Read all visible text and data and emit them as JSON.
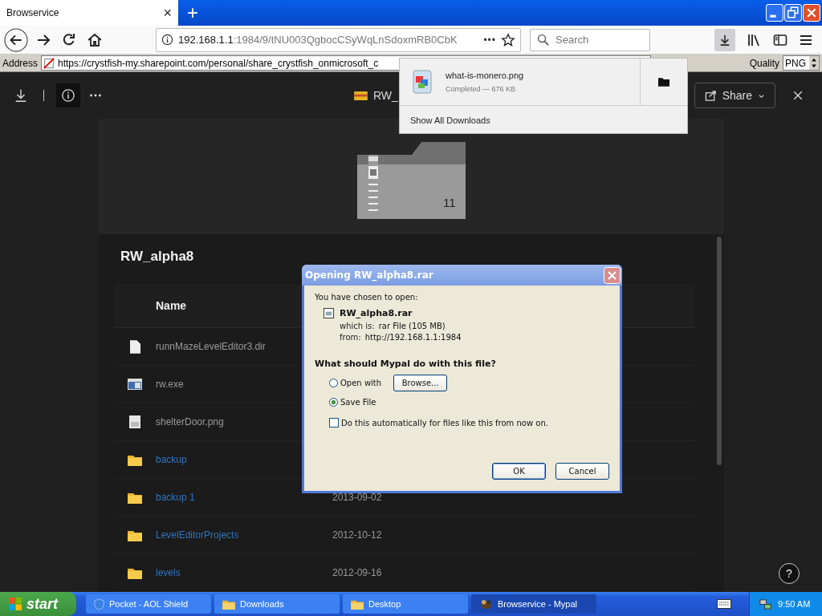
{
  "browser": {
    "tab": {
      "title": "Browservice",
      "close": "×"
    },
    "new_tab": "+",
    "url": {
      "host": "192.168.1.1",
      "path": ":1984/9/tNU003QgbocCSyWqLnSdoxmRB0CbK"
    },
    "page_actions": "•••",
    "search": {
      "placeholder": "Search"
    },
    "downloads_active": true
  },
  "address_bar": {
    "label": "Address",
    "value": "https://crystfish-my.sharepoint.com/personal/share_crystfish_onmicrosoft_c",
    "quality_label": "Quality",
    "quality_value": "PNG"
  },
  "downloads_panel": {
    "items": [
      {
        "name": "what-is-monero.png",
        "status": "Completed — 676 KB"
      }
    ],
    "show_all": "Show All Downloads"
  },
  "viewer": {
    "info_active": true,
    "title": "RW_",
    "share": "Share",
    "folder_count": "11"
  },
  "listing": {
    "title": "RW_alpha8",
    "columns": [
      "Name"
    ],
    "rows": [
      {
        "kind": "file",
        "name": "runnMazeLevelEditor3.dir"
      },
      {
        "kind": "exe",
        "name": "rw.exe"
      },
      {
        "kind": "image",
        "name": "shelterDoor.png"
      },
      {
        "kind": "folder",
        "name": "backup"
      },
      {
        "kind": "folder",
        "name": "backup 1",
        "date": "2013-09-02"
      },
      {
        "kind": "folder",
        "name": "LevelEditorProjects",
        "date": "2012-10-12"
      },
      {
        "kind": "folder",
        "name": "levels",
        "date": "2012-09-16"
      }
    ]
  },
  "help": "?",
  "dialog": {
    "title": "Opening RW_alpha8.rar",
    "intro": "You have chosen to open:",
    "file": "RW_alpha8.rar",
    "which_label": "which is:",
    "which": "rar File (105 MB)",
    "from_label": "from:",
    "from": "http://192.168.1.1:1984",
    "question": "What should Mypal do with this file?",
    "options": [
      {
        "label": "Open with",
        "selected": false
      },
      {
        "label": "Save File",
        "selected": true
      }
    ],
    "browse": "Browse...",
    "auto": {
      "label": "Do this automatically for files like this from now on.",
      "checked": false
    },
    "buttons": [
      "OK",
      "Cancel"
    ]
  },
  "taskbar": {
    "start": "start",
    "items": [
      {
        "kind": "shield",
        "label": "Pocket - AOL Shield",
        "selected": false
      },
      {
        "kind": "folder",
        "label": "Downloads",
        "selected": false
      },
      {
        "kind": "folder",
        "label": "Desktop",
        "selected": false
      },
      {
        "kind": "app",
        "label": "Browservice - Mypal",
        "selected": true
      }
    ],
    "clock": "9:50 AM"
  }
}
